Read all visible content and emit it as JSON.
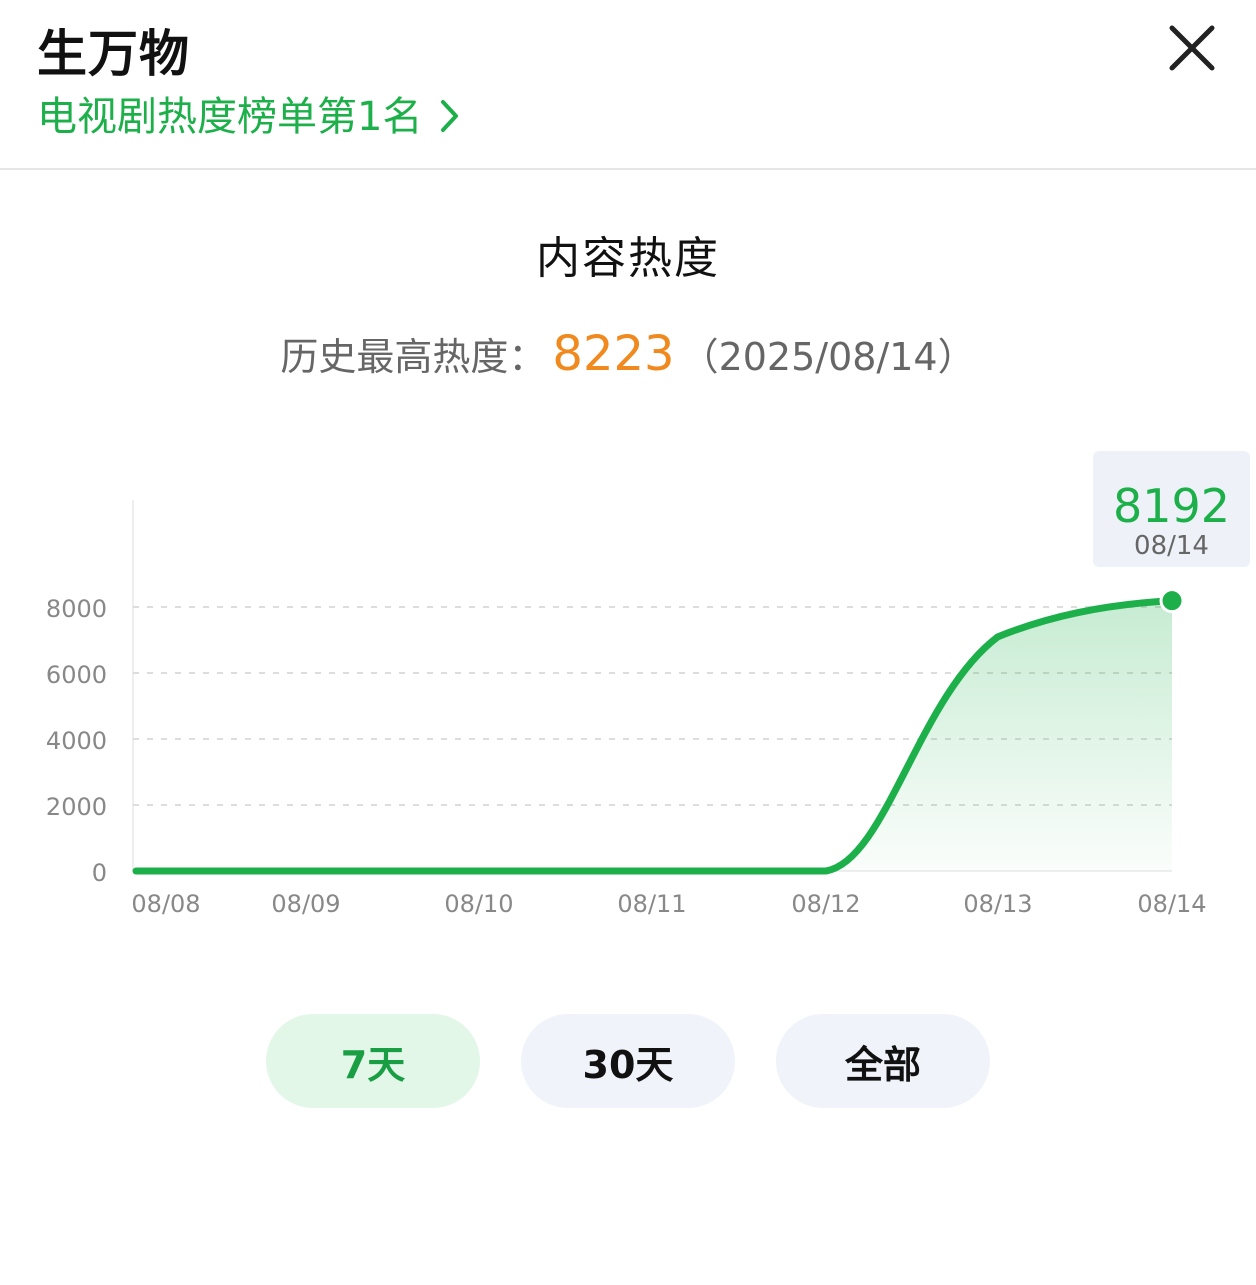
{
  "header": {
    "title": "生万物",
    "rank_text": "电视剧热度榜单第1名"
  },
  "section_title": "内容热度",
  "peak": {
    "label": "历史最高热度：",
    "value": "8223",
    "date": "（2025/08/14）"
  },
  "tooltip": {
    "value": "8192",
    "date": "08/14"
  },
  "range_tabs": [
    {
      "label": "7天",
      "active": true
    },
    {
      "label": "30天",
      "active": false
    },
    {
      "label": "全部",
      "active": false
    }
  ],
  "colors": {
    "accent": "#1db04a",
    "peak": "#f0891e",
    "grid": "#dddddd",
    "axis_text": "#888888"
  },
  "chart_data": {
    "type": "area",
    "x": [
      "08/08",
      "08/09",
      "08/10",
      "08/11",
      "08/12",
      "08/13",
      "08/14"
    ],
    "series": [
      {
        "values": [
          0,
          0,
          0,
          0,
          0,
          7100,
          8192
        ]
      }
    ],
    "yticks": [
      0,
      2000,
      4000,
      6000,
      8000
    ],
    "ylim": [
      0,
      8000
    ],
    "grid": true,
    "highlight": {
      "x": "08/14",
      "value": 8192
    }
  }
}
